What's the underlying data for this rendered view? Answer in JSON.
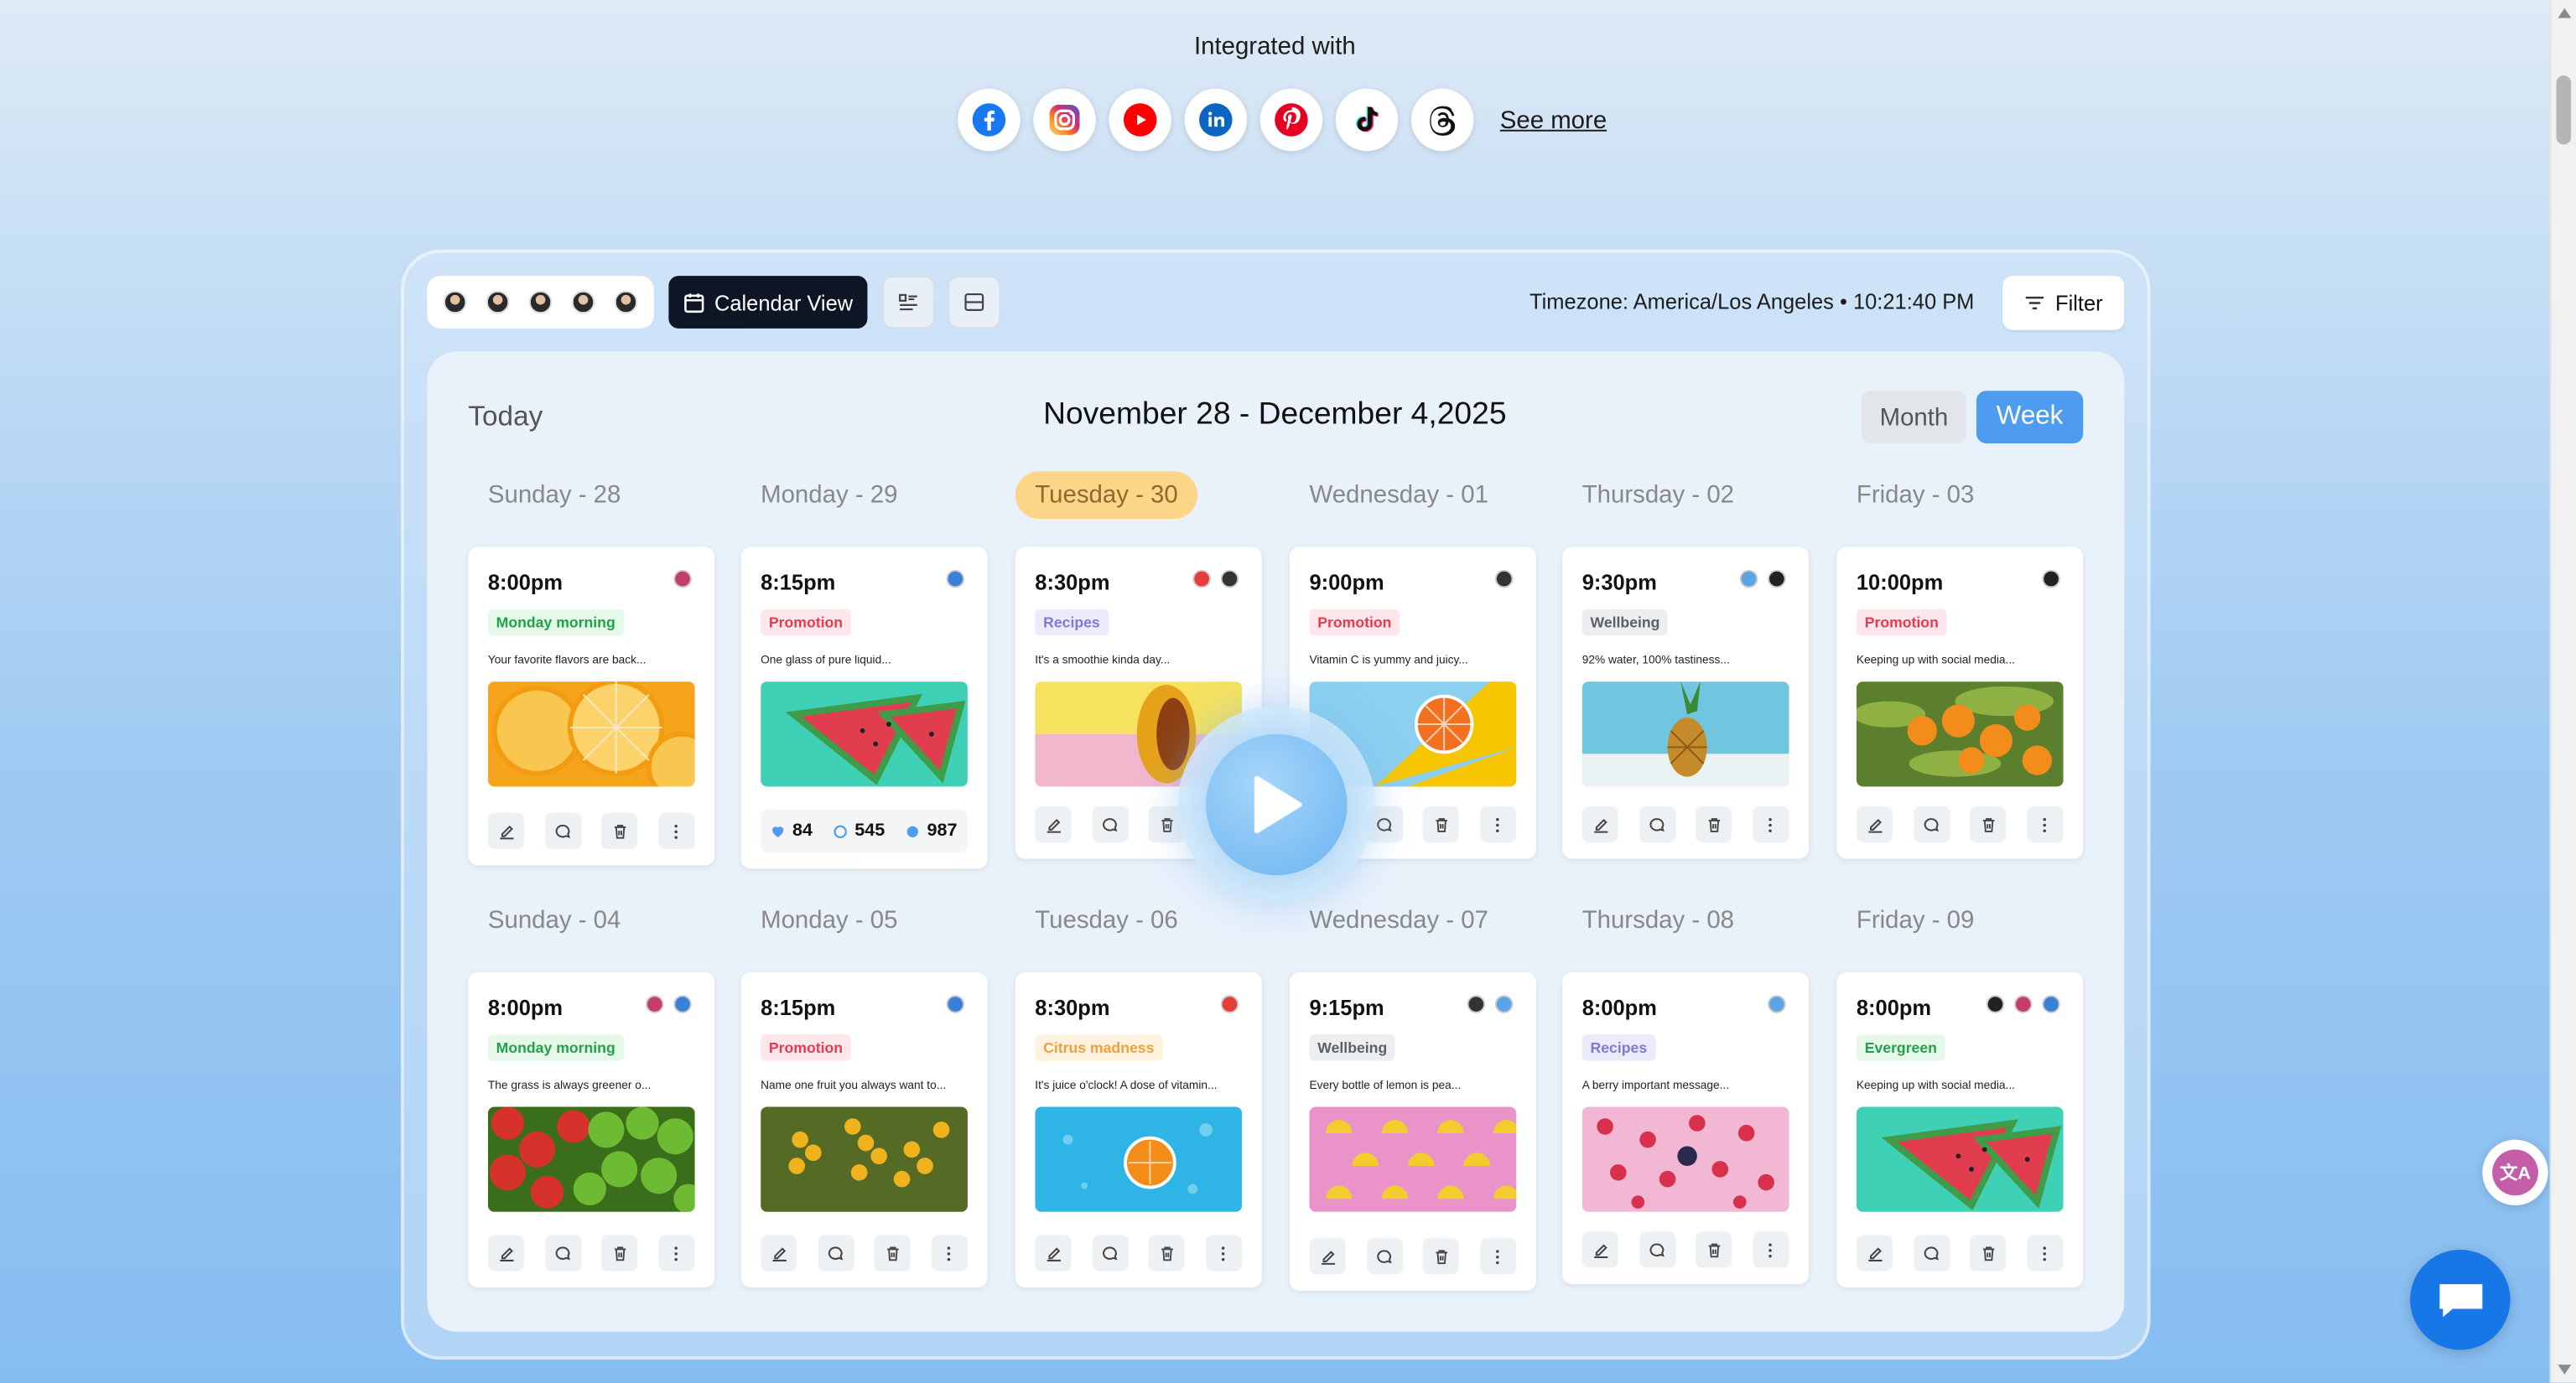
{
  "header": {
    "integrated_label": "Integrated with",
    "see_more": "See more"
  },
  "social_icons": [
    "facebook-icon",
    "instagram-icon",
    "youtube-icon",
    "linkedin-icon",
    "pinterest-icon",
    "tiktok-icon",
    "threads-icon"
  ],
  "toolbar": {
    "calendar_view_label": "Calendar View",
    "timezone_text": "Timezone: America/Los Angeles • 10:21:40 PM",
    "filter_label": "Filter"
  },
  "calendar": {
    "today_label": "Today",
    "range_title": "November 28 - December 4,2025",
    "month_label": "Month",
    "week_label": "Week"
  },
  "days": [
    {
      "label": "Sunday - 28"
    },
    {
      "label": "Monday - 29"
    },
    {
      "label": "Tuesday - 30"
    },
    {
      "label": "Wednesday - 01"
    },
    {
      "label": "Thursday - 02"
    },
    {
      "label": "Friday - 03"
    },
    {
      "label": "Sunday - 04"
    },
    {
      "label": "Monday - 05"
    },
    {
      "label": "Tuesday - 06"
    },
    {
      "label": "Wednesday - 07"
    },
    {
      "label": "Thursday - 08"
    },
    {
      "label": "Friday - 09"
    }
  ],
  "cards": [
    {
      "time": "8:00pm",
      "tag": "Monday morning",
      "caption": "Your favorite flavors are back...",
      "image": "oranges"
    },
    {
      "time": "8:15pm",
      "tag": "Promotion",
      "caption": "One glass of pure liquid...",
      "image": "watermelon",
      "stats": {
        "likes": "84",
        "comments": "545",
        "shares": "987"
      }
    },
    {
      "time": "8:30pm",
      "tag": "Recipes",
      "caption": "It's a smoothie kinda day...",
      "image": "mango"
    },
    {
      "time": "9:00pm",
      "tag": "Promotion",
      "caption": "Vitamin C is yummy and juicy...",
      "image": "grapefruit"
    },
    {
      "time": "9:30pm",
      "tag": "Wellbeing",
      "caption": "92% water, 100% tastiness...",
      "image": "pineapple"
    },
    {
      "time": "10:00pm",
      "tag": "Promotion",
      "caption": "Keeping up with social media...",
      "image": "orange-tree"
    },
    {
      "time": "8:00pm",
      "tag": "Monday morning",
      "caption": "The grass is always greener o...",
      "image": "apples"
    },
    {
      "time": "8:15pm",
      "tag": "Promotion",
      "caption": "Name one fruit you always want to...",
      "image": "yellow-berries"
    },
    {
      "time": "8:30pm",
      "tag": "Citrus madness",
      "caption": "It's juice o'clock! A dose of vitamin...",
      "image": "orange-water"
    },
    {
      "time": "9:15pm",
      "tag": "Wellbeing",
      "caption": "Every bottle of lemon is pea...",
      "image": "lemons-pink"
    },
    {
      "time": "8:00pm",
      "tag": "Recipes",
      "caption": "A berry important message...",
      "image": "raspberries"
    },
    {
      "time": "8:00pm",
      "tag": "Evergreen",
      "caption": "Keeping up with social media...",
      "image": "watermelon"
    }
  ],
  "tag_colors": {
    "Monday morning": {
      "bg": "#e5f8ea",
      "fg": "#22a04a"
    },
    "Promotion": {
      "bg": "#fde7ea",
      "fg": "#e23b54"
    },
    "Recipes": {
      "bg": "#ecebfb",
      "fg": "#7d79d8"
    },
    "Wellbeing": {
      "bg": "#eceef0",
      "fg": "#5b6067"
    },
    "Citrus madness": {
      "bg": "#fff3df",
      "fg": "#f0a03a"
    },
    "Evergreen": {
      "bg": "#e5f8ea",
      "fg": "#22a04a"
    }
  },
  "translate_label": "文A"
}
